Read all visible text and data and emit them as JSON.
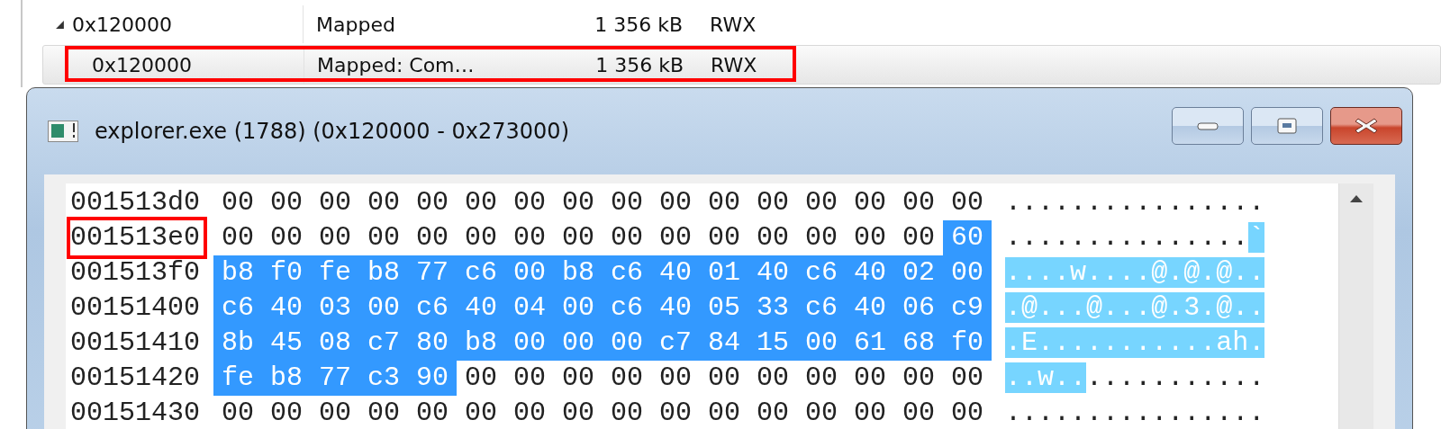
{
  "regions": [
    {
      "address": "0x120000",
      "type": "Mapped",
      "size": "1 356 kB",
      "protection": "RWX",
      "expanded": true,
      "selected": false,
      "annotated": false,
      "children": [
        {
          "address": "0x120000",
          "type": "Mapped: Com…",
          "size": "1 356 kB",
          "protection": "RWX",
          "selected": true,
          "annotated": true
        }
      ]
    }
  ],
  "window": {
    "title": "explorer.exe (1788) (0x120000 - 0x273000)"
  },
  "hex_rows": [
    {
      "address": "001513d0",
      "annotated": false,
      "ascii": "................",
      "bytes": [
        {
          "v": "00",
          "selected": false
        },
        {
          "v": "00",
          "selected": false
        },
        {
          "v": "00",
          "selected": false
        },
        {
          "v": "00",
          "selected": false
        },
        {
          "v": "00",
          "selected": false
        },
        {
          "v": "00",
          "selected": false
        },
        {
          "v": "00",
          "selected": false
        },
        {
          "v": "00",
          "selected": false
        },
        {
          "v": "00",
          "selected": false
        },
        {
          "v": "00",
          "selected": false
        },
        {
          "v": "00",
          "selected": false
        },
        {
          "v": "00",
          "selected": false
        },
        {
          "v": "00",
          "selected": false
        },
        {
          "v": "00",
          "selected": false
        },
        {
          "v": "00",
          "selected": false
        },
        {
          "v": "00",
          "selected": false
        }
      ]
    },
    {
      "address": "001513e0",
      "annotated": true,
      "ascii": "...............`",
      "bytes": [
        {
          "v": "00",
          "selected": false
        },
        {
          "v": "00",
          "selected": false
        },
        {
          "v": "00",
          "selected": false
        },
        {
          "v": "00",
          "selected": false
        },
        {
          "v": "00",
          "selected": false
        },
        {
          "v": "00",
          "selected": false
        },
        {
          "v": "00",
          "selected": false
        },
        {
          "v": "00",
          "selected": false
        },
        {
          "v": "00",
          "selected": false
        },
        {
          "v": "00",
          "selected": false
        },
        {
          "v": "00",
          "selected": false
        },
        {
          "v": "00",
          "selected": false
        },
        {
          "v": "00",
          "selected": false
        },
        {
          "v": "00",
          "selected": false
        },
        {
          "v": "00",
          "selected": false
        },
        {
          "v": "60",
          "selected": true
        }
      ]
    },
    {
      "address": "001513f0",
      "annotated": false,
      "ascii": "....w....@.@.@..",
      "bytes": [
        {
          "v": "b8",
          "selected": true
        },
        {
          "v": "f0",
          "selected": true
        },
        {
          "v": "fe",
          "selected": true
        },
        {
          "v": "b8",
          "selected": true
        },
        {
          "v": "77",
          "selected": true
        },
        {
          "v": "c6",
          "selected": true
        },
        {
          "v": "00",
          "selected": true
        },
        {
          "v": "b8",
          "selected": true
        },
        {
          "v": "c6",
          "selected": true
        },
        {
          "v": "40",
          "selected": true
        },
        {
          "v": "01",
          "selected": true
        },
        {
          "v": "40",
          "selected": true
        },
        {
          "v": "c6",
          "selected": true
        },
        {
          "v": "40",
          "selected": true
        },
        {
          "v": "02",
          "selected": true
        },
        {
          "v": "00",
          "selected": true
        }
      ]
    },
    {
      "address": "00151400",
      "annotated": false,
      "ascii": ".@...@...@.3.@..",
      "bytes": [
        {
          "v": "c6",
          "selected": true
        },
        {
          "v": "40",
          "selected": true
        },
        {
          "v": "03",
          "selected": true
        },
        {
          "v": "00",
          "selected": true
        },
        {
          "v": "c6",
          "selected": true
        },
        {
          "v": "40",
          "selected": true
        },
        {
          "v": "04",
          "selected": true
        },
        {
          "v": "00",
          "selected": true
        },
        {
          "v": "c6",
          "selected": true
        },
        {
          "v": "40",
          "selected": true
        },
        {
          "v": "05",
          "selected": true
        },
        {
          "v": "33",
          "selected": true
        },
        {
          "v": "c6",
          "selected": true
        },
        {
          "v": "40",
          "selected": true
        },
        {
          "v": "06",
          "selected": true
        },
        {
          "v": "c9",
          "selected": true
        }
      ]
    },
    {
      "address": "00151410",
      "annotated": false,
      "ascii": ".E...........ah.",
      "bytes": [
        {
          "v": "8b",
          "selected": true
        },
        {
          "v": "45",
          "selected": true
        },
        {
          "v": "08",
          "selected": true
        },
        {
          "v": "c7",
          "selected": true
        },
        {
          "v": "80",
          "selected": true
        },
        {
          "v": "b8",
          "selected": true
        },
        {
          "v": "00",
          "selected": true
        },
        {
          "v": "00",
          "selected": true
        },
        {
          "v": "00",
          "selected": true
        },
        {
          "v": "c7",
          "selected": true
        },
        {
          "v": "84",
          "selected": true
        },
        {
          "v": "15",
          "selected": true
        },
        {
          "v": "00",
          "selected": true
        },
        {
          "v": "61",
          "selected": true
        },
        {
          "v": "68",
          "selected": true
        },
        {
          "v": "f0",
          "selected": true
        }
      ]
    },
    {
      "address": "00151420",
      "annotated": false,
      "ascii": "..w.............",
      "bytes": [
        {
          "v": "fe",
          "selected": true
        },
        {
          "v": "b8",
          "selected": true
        },
        {
          "v": "77",
          "selected": true
        },
        {
          "v": "c3",
          "selected": true
        },
        {
          "v": "90",
          "selected": true
        },
        {
          "v": "00",
          "selected": false
        },
        {
          "v": "00",
          "selected": false
        },
        {
          "v": "00",
          "selected": false
        },
        {
          "v": "00",
          "selected": false
        },
        {
          "v": "00",
          "selected": false
        },
        {
          "v": "00",
          "selected": false
        },
        {
          "v": "00",
          "selected": false
        },
        {
          "v": "00",
          "selected": false
        },
        {
          "v": "00",
          "selected": false
        },
        {
          "v": "00",
          "selected": false
        },
        {
          "v": "00",
          "selected": false
        }
      ]
    },
    {
      "address": "00151430",
      "annotated": false,
      "ascii": "................",
      "bytes": [
        {
          "v": "00",
          "selected": false
        },
        {
          "v": "00",
          "selected": false
        },
        {
          "v": "00",
          "selected": false
        },
        {
          "v": "00",
          "selected": false
        },
        {
          "v": "00",
          "selected": false
        },
        {
          "v": "00",
          "selected": false
        },
        {
          "v": "00",
          "selected": false
        },
        {
          "v": "00",
          "selected": false
        },
        {
          "v": "00",
          "selected": false
        },
        {
          "v": "00",
          "selected": false
        },
        {
          "v": "00",
          "selected": false
        },
        {
          "v": "00",
          "selected": false
        },
        {
          "v": "00",
          "selected": false
        },
        {
          "v": "00",
          "selected": false
        },
        {
          "v": "00",
          "selected": false
        },
        {
          "v": "00",
          "selected": false
        }
      ]
    }
  ]
}
